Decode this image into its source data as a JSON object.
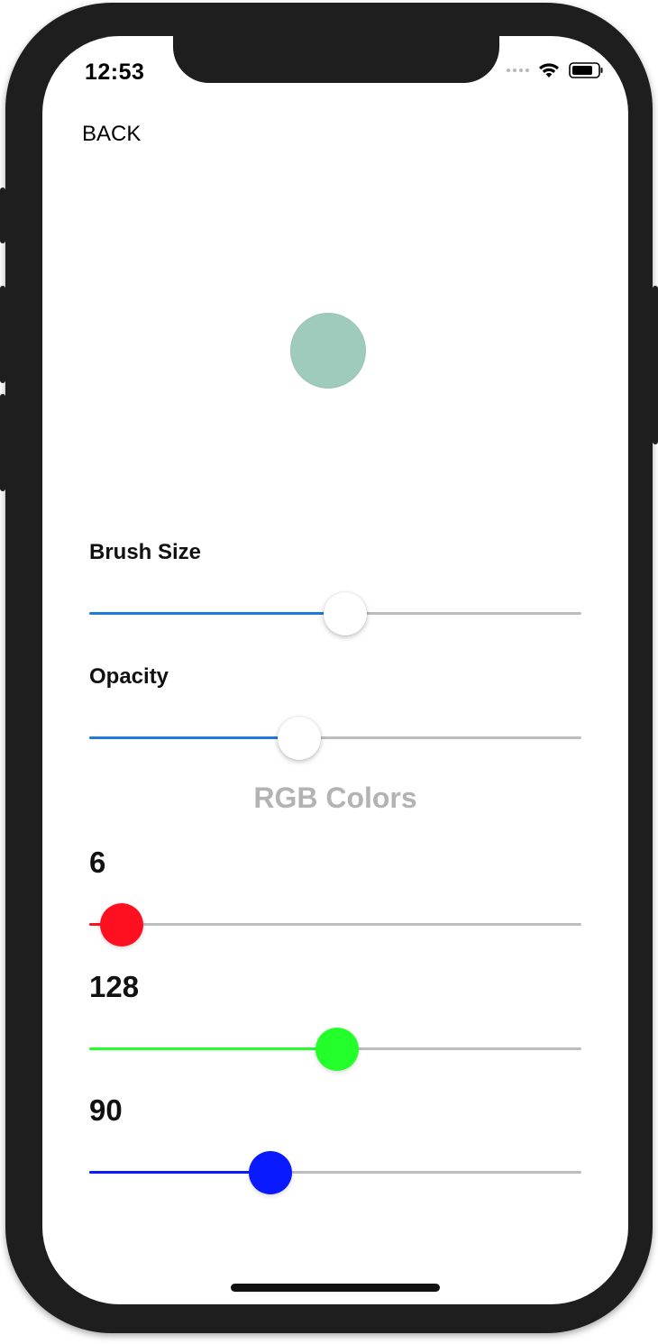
{
  "status_bar": {
    "time": "12:53",
    "wifi_icon": "wifi-icon",
    "battery_icon": "battery-icon"
  },
  "nav": {
    "back_label": "BACK"
  },
  "preview": {
    "color": "#9ecbbc"
  },
  "brush_size": {
    "label": "Brush Size",
    "value_fraction": 0.52,
    "fill_color": "#1f7ae0"
  },
  "opacity": {
    "label": "Opacity",
    "value_fraction": 0.427,
    "fill_color": "#1f7ae0"
  },
  "rgb": {
    "title": "RGB Colors",
    "red": {
      "value": "6",
      "fraction": 0.066,
      "color": "#ff1020"
    },
    "green": {
      "value": "128",
      "fraction": 0.503,
      "color": "#22ff2a"
    },
    "blue": {
      "value": "90",
      "fraction": 0.368,
      "color": "#0a1aff"
    }
  }
}
